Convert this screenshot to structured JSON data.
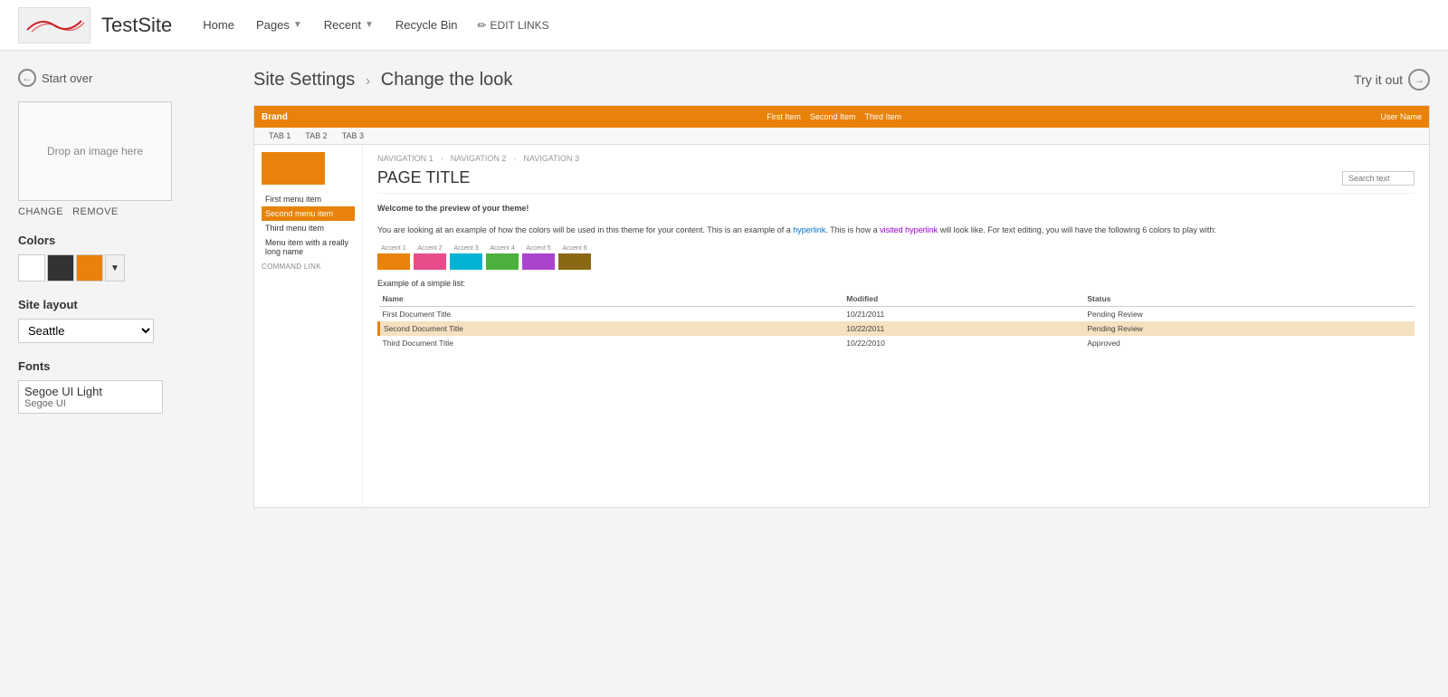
{
  "site": {
    "title": "TestSite",
    "logo_alt": "Site Logo"
  },
  "nav": {
    "home": "Home",
    "pages": "Pages",
    "recent": "Recent",
    "recycle_bin": "Recycle Bin",
    "edit_links": "EDIT LINKS"
  },
  "left_panel": {
    "start_over": "Start over",
    "drop_zone": "Drop an image here",
    "change": "CHANGE",
    "remove": "REMOVE",
    "colors_label": "Colors",
    "color1": "#ffffff",
    "color2": "#333333",
    "color3": "#e8820a",
    "site_layout_label": "Site layout",
    "layout_option": "Seattle",
    "fonts_label": "Fonts",
    "font_primary": "Segoe UI Light",
    "font_secondary": "Segoe UI"
  },
  "page_header": {
    "breadcrumb_parent": "Site Settings",
    "breadcrumb_child": "Change the look",
    "try_it_out": "Try it out"
  },
  "preview": {
    "brand": "Brand",
    "nav_links": [
      "First Item",
      "Second Item",
      "Third Item"
    ],
    "user": "User Name",
    "tabs": [
      "TAB 1",
      "TAB 2",
      "TAB 3"
    ],
    "subnav": [
      "NAVIGATION 1",
      "NAVIGATION 2",
      "NAVIGATION 3"
    ],
    "page_title": "PAGE TITLE",
    "search_placeholder": "Search text",
    "menu_items": [
      "First menu item",
      "Second menu item",
      "Third menu item",
      "Menu item with a really long name"
    ],
    "cmd_link": "COMMAND LINK",
    "body_intro": "Welcome to the preview of your theme!",
    "body_text": "You are looking at an example of how the colors will be used in this theme for your content. This is an example of a",
    "hyperlink": "hyperlink",
    "body_text2": ". This is how a",
    "visited_link": "visited hyperlink",
    "body_text3": "will look like. For text editing, you will have the following 6 colors to play with:",
    "accents": [
      {
        "label": "Accent 1",
        "color": "#e8820a"
      },
      {
        "label": "Accent 2",
        "color": "#e84c8b"
      },
      {
        "label": "Accent 3",
        "color": "#00b3d4"
      },
      {
        "label": "Accent 4",
        "color": "#4cb03c"
      },
      {
        "label": "Accent 5",
        "color": "#aa44cc"
      },
      {
        "label": "Accent 6",
        "color": "#8b6914"
      }
    ],
    "list_label": "Example of a simple list:",
    "table_headers": [
      "Name",
      "Modified",
      "Status"
    ],
    "table_rows": [
      {
        "name": "First Document Title",
        "modified": "10/21/2011",
        "status": "Pending Review",
        "highlighted": false
      },
      {
        "name": "Second Document Title",
        "modified": "10/22/2011",
        "status": "Pending Review",
        "highlighted": true
      },
      {
        "name": "Third Document Title",
        "modified": "10/22/2010",
        "status": "Approved",
        "highlighted": false
      }
    ]
  }
}
